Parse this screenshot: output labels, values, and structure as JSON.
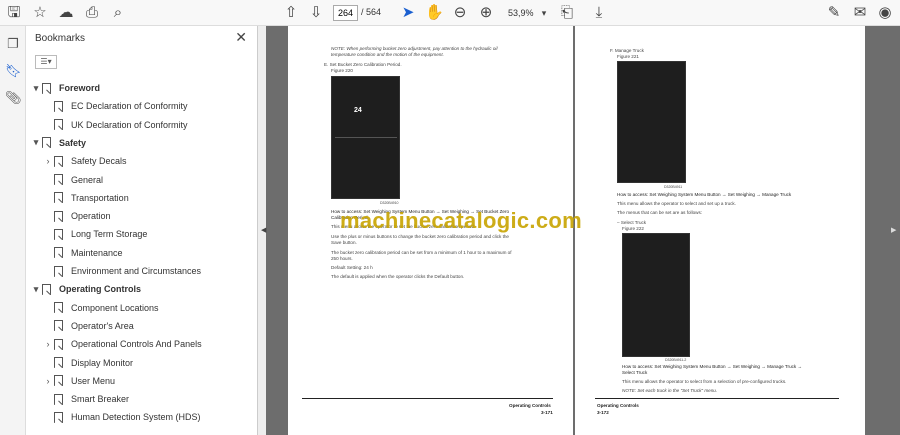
{
  "toolbar": {
    "page_current": "264",
    "page_total": "/ 564",
    "zoom": "53,9%"
  },
  "sidebar": {
    "title": "Bookmarks",
    "close": "✕",
    "options": "☰▾",
    "items": [
      {
        "label": "Foreword",
        "level": 0,
        "top": true,
        "expand": "▾"
      },
      {
        "label": "EC Declaration of Conformity",
        "level": 1
      },
      {
        "label": "UK Declaration of Conformity",
        "level": 1
      },
      {
        "label": "Safety",
        "level": 0,
        "top": true,
        "expand": "▾"
      },
      {
        "label": "Safety Decals",
        "level": 1,
        "expand": "›"
      },
      {
        "label": "General",
        "level": 1
      },
      {
        "label": "Transportation",
        "level": 1
      },
      {
        "label": "Operation",
        "level": 1
      },
      {
        "label": "Long Term Storage",
        "level": 1
      },
      {
        "label": "Maintenance",
        "level": 1
      },
      {
        "label": "Environment and Circumstances",
        "level": 1
      },
      {
        "label": "Operating Controls",
        "level": 0,
        "top": true,
        "expand": "▾"
      },
      {
        "label": "Component Locations",
        "level": 1
      },
      {
        "label": "Operator's Area",
        "level": 1
      },
      {
        "label": "Operational Controls And Panels",
        "level": 1,
        "expand": "›"
      },
      {
        "label": "Display Monitor",
        "level": 1
      },
      {
        "label": "User Menu",
        "level": 1,
        "expand": "›"
      },
      {
        "label": "Smart Breaker",
        "level": 1
      },
      {
        "label": "Human Detection System (HDS)",
        "level": 1
      }
    ]
  },
  "page_left": {
    "note": "NOTE:  When performing bucket zero adjustment, pay attention to the hydraulic oil",
    "note2": "temperature condition and the motion of the equipment.",
    "step": "E.   Set Bucket Zero Calibration Period.",
    "figure": "Figure 220",
    "screen_value": "24",
    "fig_id": "D320B4910",
    "how": "How to access: Set Weighing System Menu Button → Set Weighing → Set Bucket Zero",
    "how2": "Calibration Period",
    "p1": "This menu allows the operator to set the bucket zero calibration period.",
    "p2": "Use the plus or minus buttons to change the bucket zero calibration period and click the",
    "p2b": "Save button.",
    "p3": "The bucket zero calibration period can be set from a minimum of 1 hour to a maximum of",
    "p3b": "250 hours.",
    "p4": "Default Setting: 24 h",
    "p5": "The default is applied when the operator clicks the Default button.",
    "footer_title": "Operating Controls",
    "footer_page": "3-171"
  },
  "page_right": {
    "step": "F.   Manage Truck",
    "figure": "Figure 221",
    "fig_id": "D320B4911",
    "how": "How to access: Set Weighing System Menu Button → Set Weighing → Manage Truck",
    "p1": "This menu allows the operator to select and set up a truck.",
    "p2": "The menus that can be set are as follows:",
    "sub": "–  Select Truck",
    "figure2": "Figure 222",
    "fig_id2": "D320B4911-2",
    "how2": "How to access: Set Weighing System Menu Button → Set Weighing → Manage Truck →",
    "how2b": "Select Truck",
    "p3": "This menu allows the operator to select from a selection of pre-configured trucks.",
    "note": "NOTE:  Set each truck in the \"Set Truck\" menu.",
    "footer_title": "Operating Controls",
    "footer_page": "3-172"
  },
  "watermark": "machinecatalogic.com"
}
